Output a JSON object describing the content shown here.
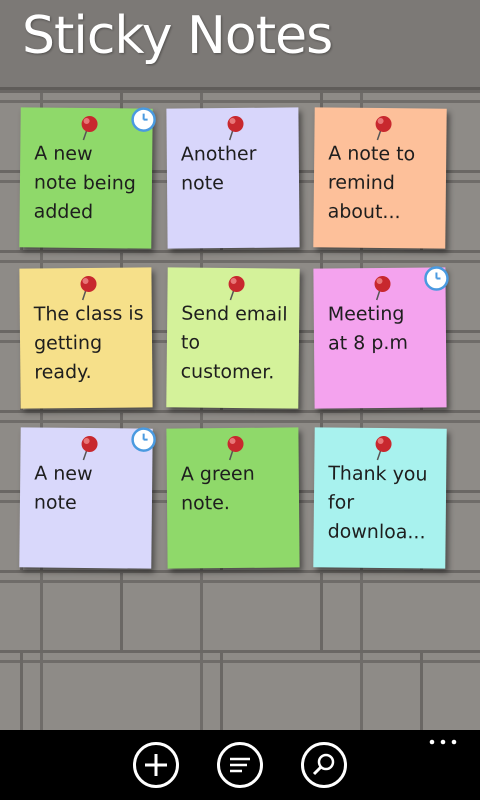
{
  "app": {
    "title": "Sticky Notes"
  },
  "notes": [
    {
      "text": "A new\nnote being\nadded",
      "color": "#8fd96a",
      "has_reminder": true
    },
    {
      "text": "Another\nnote",
      "color": "#d8d6fb",
      "has_reminder": false
    },
    {
      "text": "A note to\nremind\nabout...",
      "color": "#fdc09a",
      "has_reminder": false
    },
    {
      "text": "The class is\ngetting\nready.",
      "color": "#f6e08a",
      "has_reminder": false
    },
    {
      "text": "Send email\nto\ncustomer.",
      "color": "#d4f29a",
      "has_reminder": false
    },
    {
      "text": "Meeting\nat 8 p.m",
      "color": "#f4a3ee",
      "has_reminder": true
    },
    {
      "text": "A new\nnote",
      "color": "#d9d8fb",
      "has_reminder": true
    },
    {
      "text": "A green\nnote.",
      "color": "#8fd96a",
      "has_reminder": false
    },
    {
      "text": "Thank you\nfor\ndownloa...",
      "color": "#a8f2ee",
      "has_reminder": false
    }
  ],
  "appbar": {
    "buttons": [
      {
        "icon": "add-icon"
      },
      {
        "icon": "sort-icon"
      },
      {
        "icon": "search-icon"
      }
    ],
    "more_icon": "more-dots-icon"
  },
  "colors": {
    "wall": "#8e8b87",
    "pin_red": "#c8282e",
    "reminder_blue": "#4a9ae0"
  }
}
